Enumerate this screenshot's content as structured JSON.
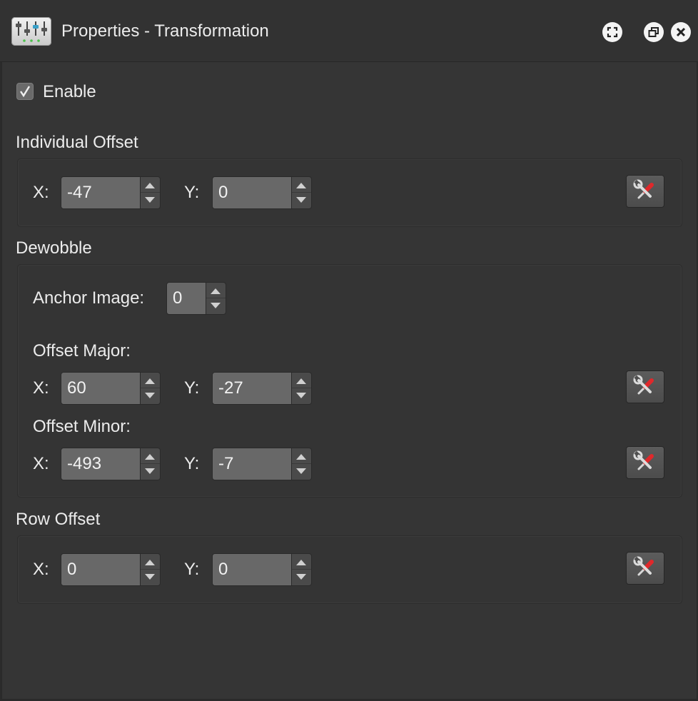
{
  "window": {
    "title": "Properties - Transformation",
    "icons": [
      "sliders-icon",
      "fullscreen-icon",
      "restore-icon",
      "close-icon"
    ]
  },
  "enable": {
    "label": "Enable",
    "checked": true
  },
  "individual_offset": {
    "heading": "Individual Offset",
    "x_label": "X:",
    "x_value": "-47",
    "y_label": "Y:",
    "y_value": "0"
  },
  "dewobble": {
    "heading": "Dewobble",
    "anchor_label": "Anchor Image:",
    "anchor_value": "0",
    "offset_major": {
      "label": "Offset Major:",
      "x_label": "X:",
      "x_value": "60",
      "y_label": "Y:",
      "y_value": "-27"
    },
    "offset_minor": {
      "label": "Offset Minor:",
      "x_label": "X:",
      "x_value": "-493",
      "y_label": "Y:",
      "y_value": "-7"
    }
  },
  "row_offset": {
    "heading": "Row Offset",
    "x_label": "X:",
    "x_value": "0",
    "y_label": "Y:",
    "y_value": "0"
  },
  "colors": {
    "background": "#353535",
    "field": "#686868",
    "text": "#ececec",
    "tool_red": "#e0282b"
  }
}
